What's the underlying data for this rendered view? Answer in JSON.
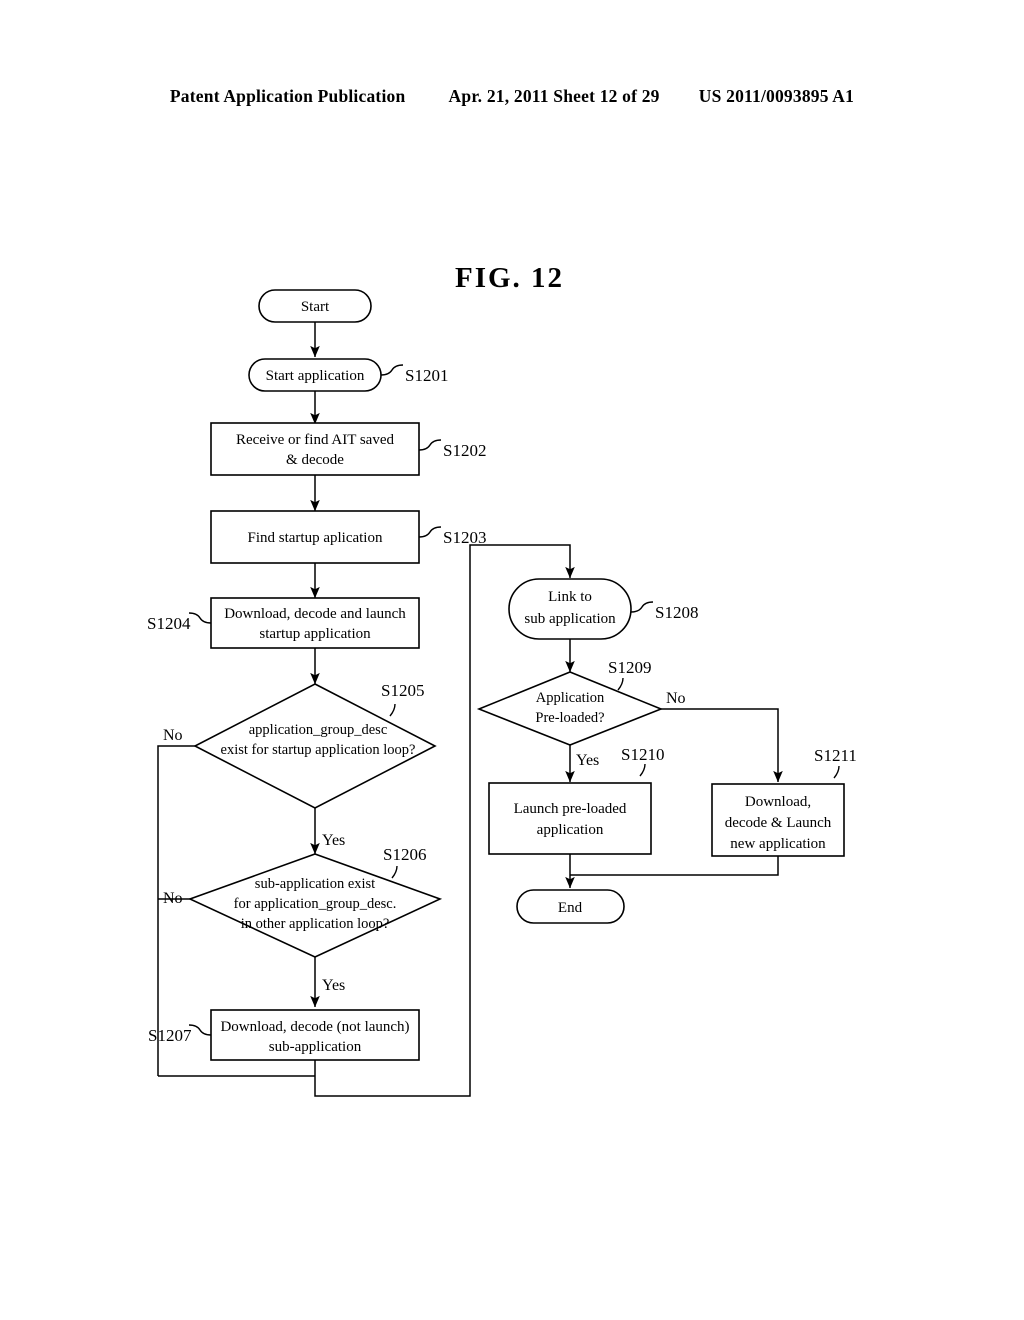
{
  "header": {
    "publication": "Patent Application Publication",
    "date_sheet": "Apr. 21, 2011  Sheet 12 of 29",
    "patent_number": "US 2011/0093895 A1"
  },
  "figure": {
    "title": "FIG. 12"
  },
  "flowchart": {
    "nodes": {
      "start": {
        "label": "Start",
        "shape": "terminator"
      },
      "s1201": {
        "label": "Start application",
        "ref": "S1201",
        "shape": "terminator"
      },
      "s1202": {
        "line1": "Receive or find AIT saved",
        "line2": "& decode",
        "ref": "S1202",
        "shape": "process"
      },
      "s1203": {
        "line1": "Find startup aplication",
        "ref": "S1203",
        "shape": "process"
      },
      "s1204": {
        "line1": "Download, decode and launch",
        "line2": "startup application",
        "ref": "S1204",
        "shape": "process"
      },
      "s1205": {
        "line1": "application_group_desc",
        "line2": "exist for startup application loop?",
        "ref": "S1205",
        "shape": "decision"
      },
      "s1206": {
        "line1": "sub-application exist",
        "line2": "for application_group_desc.",
        "line3": "in other application loop?",
        "ref": "S1206",
        "shape": "decision"
      },
      "s1207": {
        "line1": "Download, decode (not launch)",
        "line2": "sub-application",
        "ref": "S1207",
        "shape": "process"
      },
      "s1208": {
        "line1": "Link to",
        "line2": "sub application",
        "ref": "S1208",
        "shape": "terminator"
      },
      "s1209": {
        "line1": "Application",
        "line2": "Pre-loaded?",
        "ref": "S1209",
        "shape": "decision"
      },
      "s1210": {
        "line1": "Launch pre-loaded",
        "line2": "application",
        "ref": "S1210",
        "shape": "process"
      },
      "s1211": {
        "line1": "Download,",
        "line2": "decode & Launch",
        "line3": "new application",
        "ref": "S1211",
        "shape": "process"
      },
      "end": {
        "label": "End",
        "shape": "terminator"
      }
    },
    "branch_labels": {
      "s1205_no": "No",
      "s1205_yes": "Yes",
      "s1206_no": "No",
      "s1206_yes": "Yes",
      "s1209_no": "No",
      "s1209_yes": "Yes"
    },
    "colors": {
      "stroke": "#000000",
      "fill": "#ffffff",
      "background": "#ffffff"
    }
  }
}
